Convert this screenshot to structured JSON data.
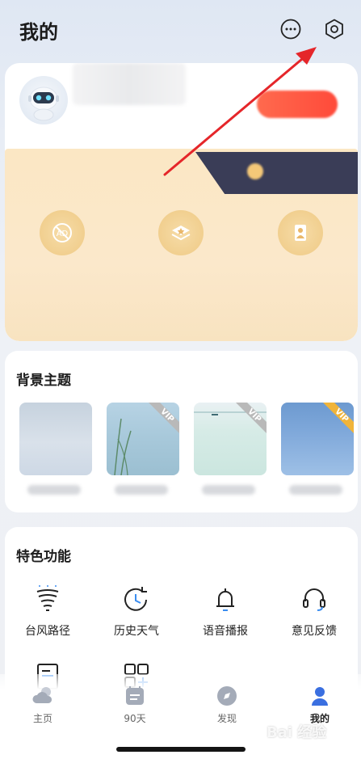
{
  "header": {
    "title": "我的"
  },
  "profile": {
    "username": "",
    "login_button": ""
  },
  "vip": {
    "center_label": "",
    "right_label": "",
    "perks": [
      {
        "icon": "no-ads-icon",
        "label": ""
      },
      {
        "icon": "theme-star-icon",
        "label": ""
      },
      {
        "icon": "voice-figure-icon",
        "label": ""
      }
    ]
  },
  "themes": {
    "title": "背景主题",
    "items": [
      {
        "name": "",
        "vip": false
      },
      {
        "name": "",
        "vip": true,
        "vip_text": "VIP"
      },
      {
        "name": "",
        "vip": true,
        "vip_text": "VIP"
      },
      {
        "name": "",
        "vip": true,
        "vip_text": "VIP"
      }
    ]
  },
  "features": {
    "title": "特色功能",
    "items": [
      {
        "label": "台风路径",
        "icon": "typhoon-icon"
      },
      {
        "label": "历史天气",
        "icon": "history-clock-icon"
      },
      {
        "label": "语音播报",
        "icon": "bell-icon"
      },
      {
        "label": "意见反馈",
        "icon": "headset-icon"
      },
      {
        "label": "",
        "icon": "document-icon"
      },
      {
        "label": "",
        "icon": "grid-add-icon"
      }
    ]
  },
  "tabbar": {
    "items": [
      {
        "label": "主页",
        "icon": "cloud-icon",
        "active": false
      },
      {
        "label": "90天",
        "icon": "calendar-icon",
        "active": false
      },
      {
        "label": "发现",
        "icon": "compass-icon",
        "active": false
      },
      {
        "label": "我的",
        "icon": "person-icon",
        "active": true
      }
    ]
  },
  "watermark": "Bai 经验",
  "colors": {
    "accent": "#ff5a40",
    "vip_gold": "#f1cf8f",
    "vip_dark": "#3a3d57",
    "annotation_arrow": "#e5262a"
  }
}
